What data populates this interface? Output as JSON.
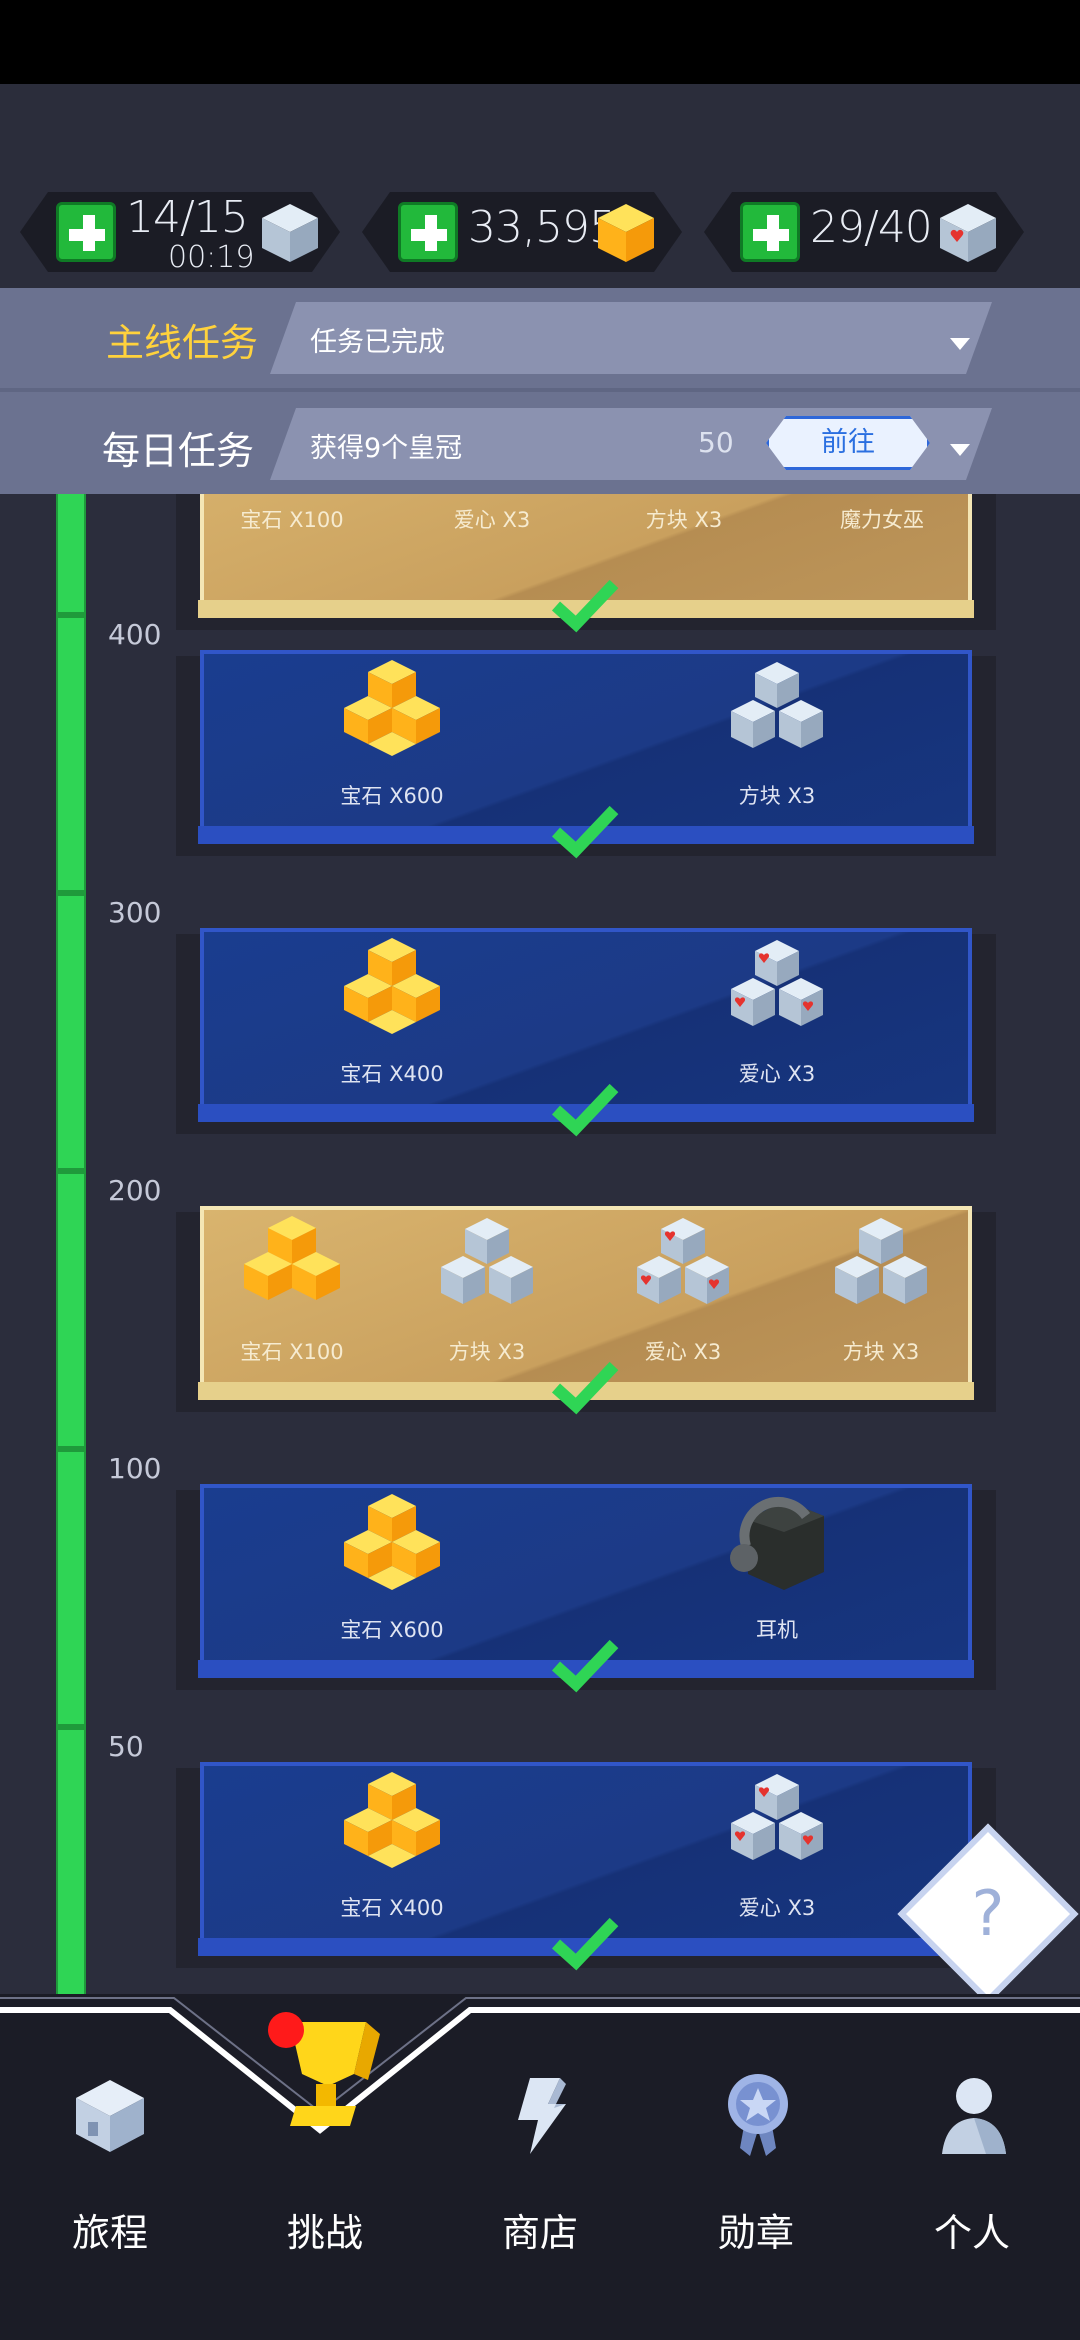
{
  "resources": [
    {
      "value": "14/15",
      "sub": "00:19",
      "icon": "block-cube-icon"
    },
    {
      "value": "33,595",
      "icon": "gem-icon"
    },
    {
      "value": "29/40",
      "icon": "heart-cube-icon"
    }
  ],
  "tasks": {
    "main_label": "主线任务",
    "main_text": "任务已完成",
    "daily_label": "每日任务",
    "daily_text": "获得9个皇冠",
    "daily_count": "50",
    "goto_label": "前往"
  },
  "top_card": {
    "items": [
      "宝石 X100",
      "爱心 X3",
      "方块 X3",
      "魔力女巫"
    ]
  },
  "rewards": [
    {
      "level": "400",
      "style": "blue",
      "items": [
        "宝石 X600",
        "方块 X3"
      ]
    },
    {
      "level": "300",
      "style": "blue",
      "items": [
        "宝石 X400",
        "爱心 X3"
      ]
    },
    {
      "level": "200",
      "style": "gold",
      "items": [
        "宝石 X100",
        "方块 X3",
        "爱心 X3",
        "方块 X3"
      ]
    },
    {
      "level": "100",
      "style": "blue",
      "items": [
        "宝石 X600",
        "耳机"
      ]
    },
    {
      "level": "50",
      "style": "blue",
      "items": [
        "宝石 X400",
        "爱心 X3"
      ]
    }
  ],
  "help_label": "?",
  "nav": {
    "items": [
      "旅程",
      "挑战",
      "商店",
      "勋章",
      "个人"
    ]
  },
  "colors": {
    "accent_green": "#2fd555",
    "main_task_label": "#ffd23c",
    "card_blue": "#1c3a86",
    "card_gold": "#c9a05e",
    "badge": "#ff1a1a"
  }
}
